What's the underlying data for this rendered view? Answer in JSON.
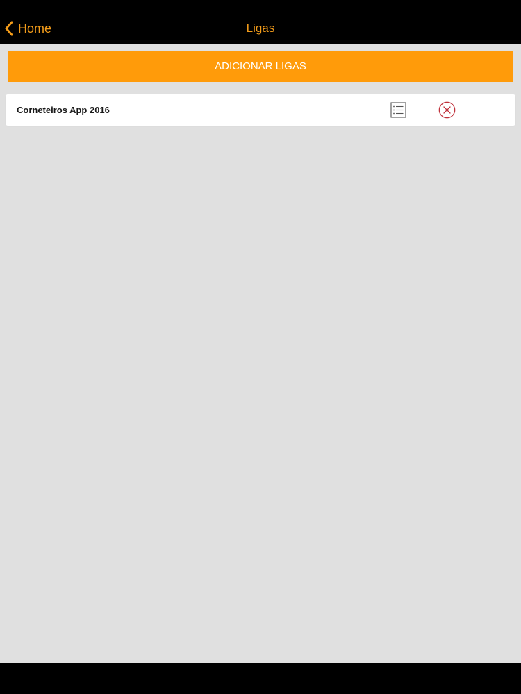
{
  "navbar": {
    "back_label": "Home",
    "title": "Ligas",
    "accent_color": "#f39c1a"
  },
  "actions": {
    "add_leagues_label": "ADICIONAR LIGAS",
    "button_color": "#ff9b0a"
  },
  "leagues": [
    {
      "name": "Corneteiros App 2016",
      "details_icon": "list-icon",
      "remove_icon": "close-circle-icon",
      "remove_color": "#c0323c"
    }
  ]
}
